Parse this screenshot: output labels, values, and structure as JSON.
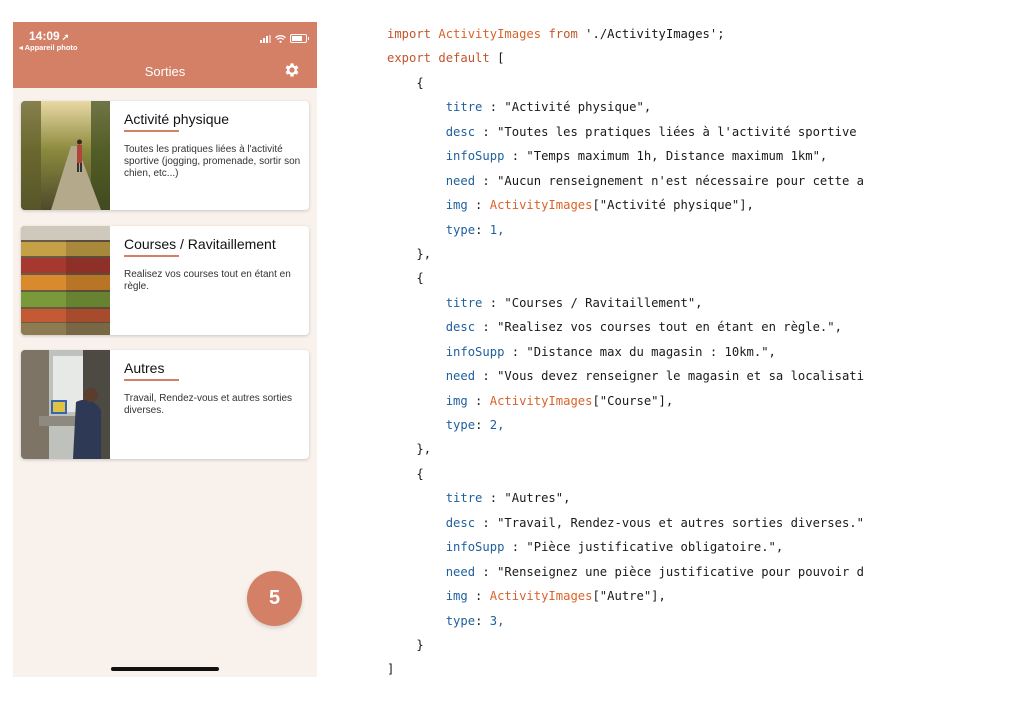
{
  "phone": {
    "status": {
      "time": "14:09",
      "back_app": "◂ Appareil photo"
    },
    "title": "Sorties",
    "cards": [
      {
        "title": "Activité physique",
        "desc": "Toutes les pratiques liées à l'activité sportive (jogging, promenade, sortir son chien, etc...)"
      },
      {
        "title": "Courses / Ravitaillement",
        "desc": "Realisez vos courses tout en étant en règle."
      },
      {
        "title": "Autres",
        "desc": "Travail, Rendez-vous et autres sorties diverses."
      }
    ],
    "badge": "5",
    "colors": {
      "accent": "#d48067",
      "background": "#f8f1ec"
    }
  },
  "code": {
    "import_kw": "import",
    "import_name": "ActivityImages",
    "from_kw": "from",
    "import_path": "'./ActivityImages';",
    "export_kw": "export default",
    "open_array": "[",
    "close_array": "]",
    "items": [
      {
        "titre": "\"Activité physique\",",
        "desc": "\"Toutes les pratiques liées à l'activité sportive",
        "infoSupp": "\"Temps maximum 1h, Distance maximum 1km\",",
        "need": "\"Aucun renseignement n'est nécessaire pour cette a",
        "img_key": "[\"Activité physique\"],",
        "type": "1,",
        "close": "},"
      },
      {
        "titre": "\"Courses / Ravitaillement\",",
        "desc": "\"Realisez vos courses tout en étant en règle.\",",
        "infoSupp": "\"Distance max du magasin : 10km.\",",
        "need": "\"Vous devez renseigner le magasin et sa localisati",
        "img_key": "[\"Course\"],",
        "type": "2,",
        "close": "},"
      },
      {
        "titre": "\"Autres\",",
        "desc": "\"Travail, Rendez-vous et autres sorties diverses.\"",
        "infoSupp": "\"Pièce justificative obligatoire.\",",
        "need": "\"Renseignez une pièce justificative pour pouvoir d",
        "img_key": "[\"Autre\"],",
        "type": "3,",
        "close": "}"
      }
    ]
  }
}
